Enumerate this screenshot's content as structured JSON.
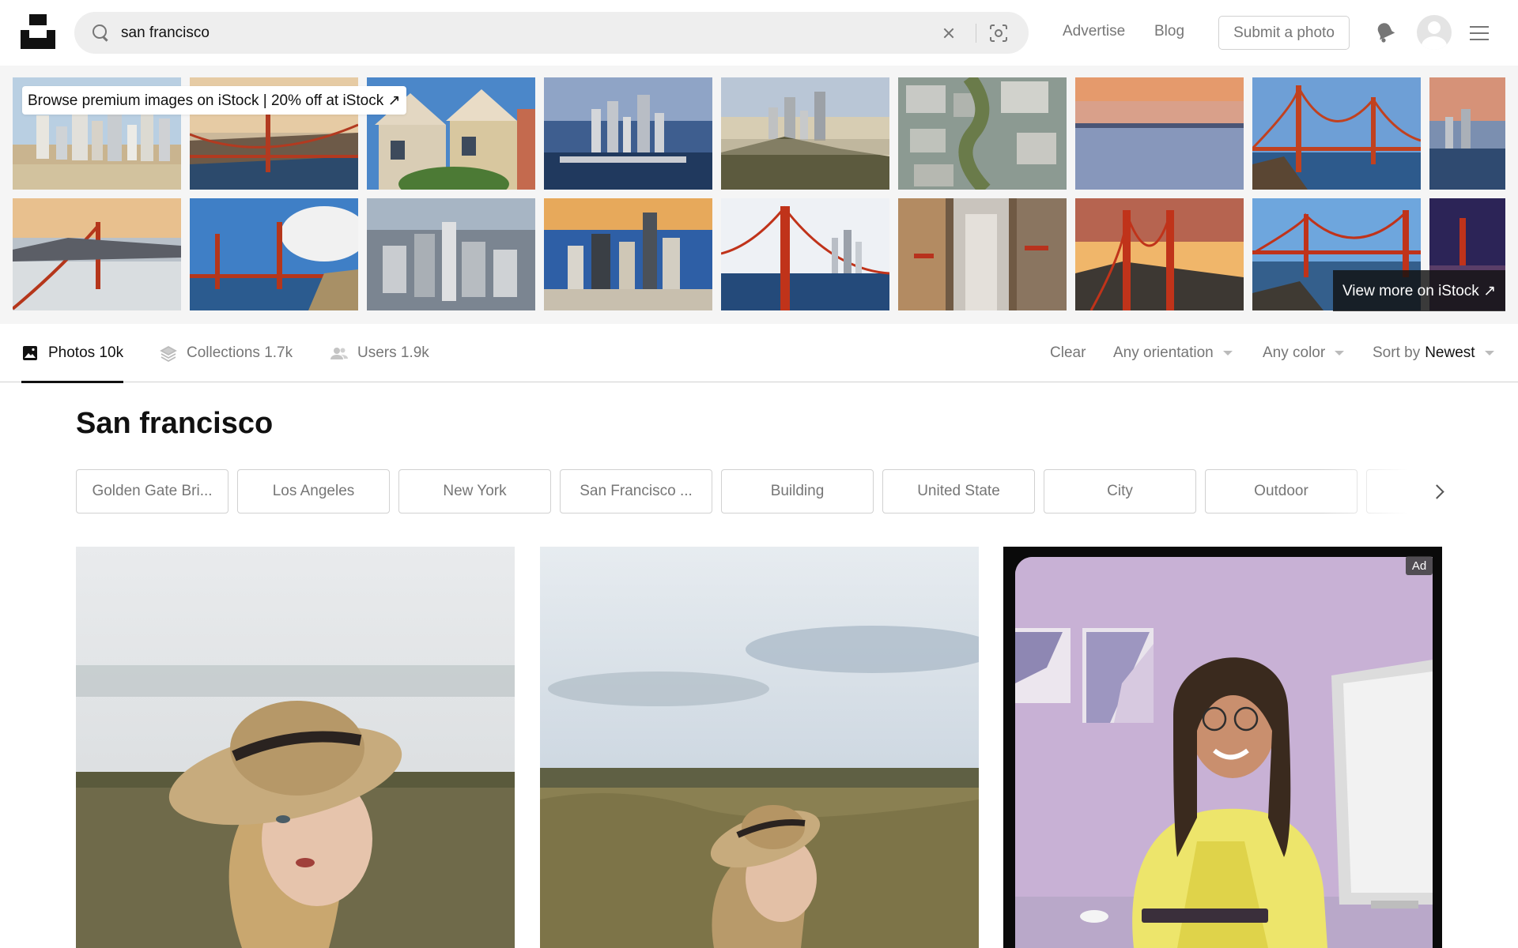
{
  "header": {
    "search_query": "san francisco",
    "nav": {
      "advertise": "Advertise",
      "blog": "Blog",
      "submit": "Submit a photo"
    }
  },
  "istock": {
    "banner": "Browse premium images on iStock | 20% off at iStock ↗",
    "view_more": "View more on iStock ↗"
  },
  "tabs": [
    {
      "label": "Photos 10k",
      "icon": "photo-icon",
      "active": true
    },
    {
      "label": "Collections 1.7k",
      "icon": "collections-icon",
      "active": false
    },
    {
      "label": "Users 1.9k",
      "icon": "users-icon",
      "active": false
    }
  ],
  "filters": {
    "clear": "Clear",
    "orientation": "Any orientation",
    "color": "Any color",
    "sort_prefix": "Sort by",
    "sort_value": "Newest"
  },
  "page_title": "San francisco",
  "related": [
    "Golden Gate Bri...",
    "Los Angeles",
    "New York",
    "San Francisco ...",
    "Building",
    "United State",
    "City",
    "Outdoor"
  ],
  "ad_label": "Ad",
  "colors": {
    "text": "#111111",
    "muted": "#767676",
    "border": "#d1d1d1",
    "strip_bg": "#f5f5f5"
  }
}
